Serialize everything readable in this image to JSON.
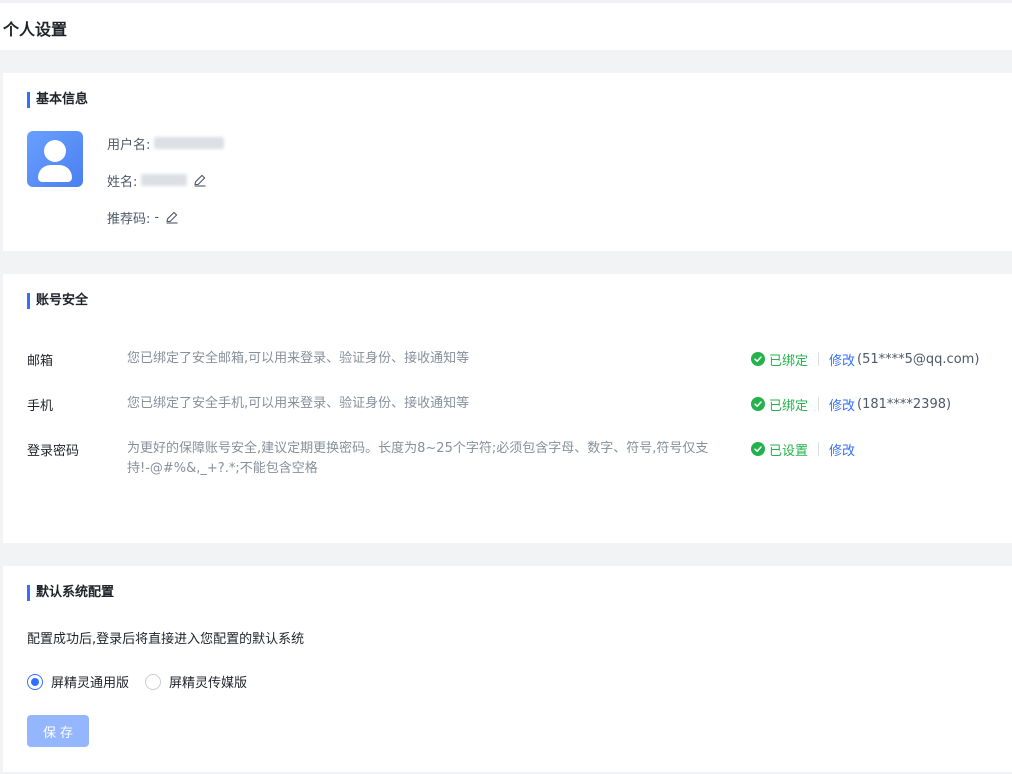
{
  "page": {
    "title": "个人设置"
  },
  "basic": {
    "title": "基本信息",
    "username_label": "用户名:",
    "name_label": "姓名:",
    "referral_label": "推荐码:",
    "referral_value": "-"
  },
  "security": {
    "title": "账号安全",
    "rows": [
      {
        "label": "邮箱",
        "desc": "您已绑定了安全邮箱,可以用来登录、验证身份、接收通知等",
        "status": "已绑定",
        "action": "修改",
        "value": "(51****5@qq.com)"
      },
      {
        "label": "手机",
        "desc": "您已绑定了安全手机,可以用来登录、验证身份、接收通知等",
        "status": "已绑定",
        "action": "修改",
        "value": "(181****2398)"
      },
      {
        "label": "登录密码",
        "desc": "为更好的保障账号安全,建议定期更换密码。长度为8~25个字符;必须包含字母、数字、符号,符号仅支持!-@#%&,_+?.*;不能包含空格",
        "status": "已设置",
        "action": "修改",
        "value": ""
      }
    ]
  },
  "default_system": {
    "title": "默认系统配置",
    "hint": "配置成功后,登录后将直接进入您配置的默认系统",
    "options": [
      "屏精灵通用版",
      "屏精灵传媒版"
    ],
    "selected": "屏精灵通用版",
    "save_label": "保存"
  },
  "colors": {
    "accent": "#3370ff",
    "success": "#23b24b",
    "button_disabled": "#94b6ff"
  },
  "icons": {
    "edit": "pencil-icon",
    "status": "check-circle-icon",
    "avatar": "user-avatar-icon"
  }
}
